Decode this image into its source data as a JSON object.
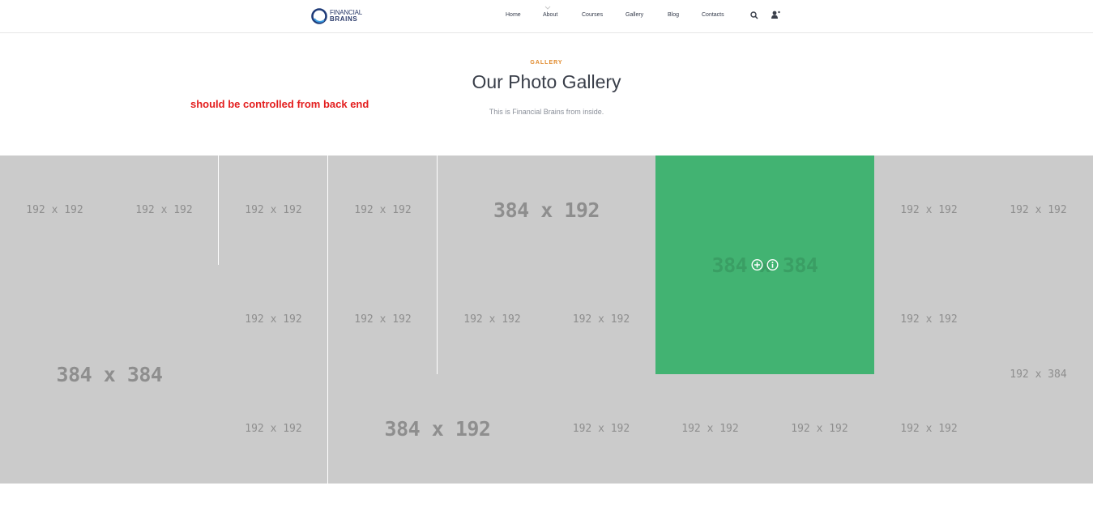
{
  "header": {
    "logo": {
      "line1": "FINANCIAL",
      "line2": "BRAINS"
    },
    "nav": [
      "Home",
      "About",
      "Courses",
      "Gallery",
      "Blog",
      "Contacts"
    ],
    "icons": {
      "search": "search-icon",
      "user": "user-icon"
    }
  },
  "section": {
    "eyebrow": "GALLERY",
    "title": "Our Photo Gallery",
    "subtitle": "This is Financial Brains from inside.",
    "note": "should be controlled from back end"
  },
  "gallery": {
    "tiles": [
      "192 x 192",
      "192 x 192",
      "192 x 192",
      "192 x 192",
      "384 x 192",
      "384 x 384",
      "192 x 192",
      "192 x 192",
      "192 x 192",
      "192 x 192",
      "192 x 192",
      "192 x 192",
      "192 x 192",
      "384 x 384",
      "192 x 192",
      "384 x 192",
      "192 x 192",
      "192 x 192",
      "192 x 192",
      "192 x 192",
      "192 x 384"
    ],
    "active_tile": "384 x 384",
    "colors": {
      "tile_bg": "#cbcbcb",
      "active_bg": "#42b372",
      "label": "#8e8e8e"
    }
  },
  "colors": {
    "accent": "#e0892b",
    "note": "#e31e1e"
  }
}
